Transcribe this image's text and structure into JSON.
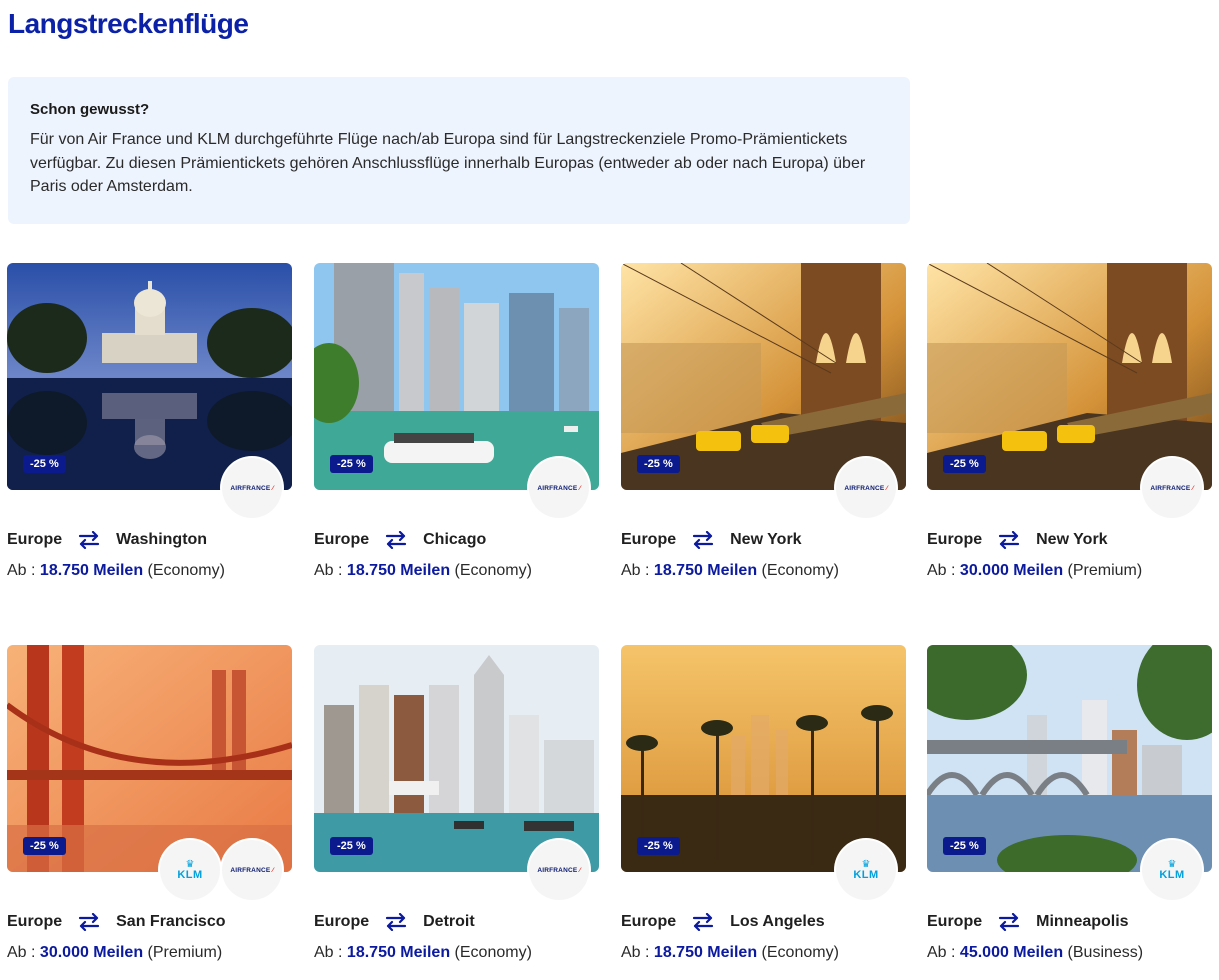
{
  "page": {
    "title": "Langstreckenflüge"
  },
  "info": {
    "title": "Schon gewusst?",
    "text": "Für von Air France und KLM durchgeführte Flüge nach/ab Europa sind für Langstreckenziele Promo-Prämientickets verfügbar. Zu diesen Prämientickets gehören Anschlussflüge innerhalb Europas (entweder ab oder nach Europa) über Paris oder Amsterdam."
  },
  "logo_text": {
    "airfrance": "AIRFRANCE",
    "klm": "KLM"
  },
  "colors": {
    "brand_blue": "#0b22a8",
    "badge": "#0b1a8c",
    "info_bg": "#eef4fd"
  },
  "cards": [
    {
      "image": "washington-capitol",
      "badge": "-25 %",
      "airlines": [
        "airfrance"
      ],
      "origin": "Europe",
      "destination": "Washington",
      "price_prefix": "Ab :",
      "miles": "18.750 Meilen",
      "cabin": "(Economy)"
    },
    {
      "image": "chicago-river",
      "badge": "-25 %",
      "airlines": [
        "airfrance"
      ],
      "origin": "Europe",
      "destination": "Chicago",
      "price_prefix": "Ab :",
      "miles": "18.750 Meilen",
      "cabin": "(Economy)"
    },
    {
      "image": "brooklyn-bridge-taxis",
      "badge": "-25 %",
      "airlines": [
        "airfrance"
      ],
      "origin": "Europe",
      "destination": "New York",
      "price_prefix": "Ab :",
      "miles": "18.750 Meilen",
      "cabin": "(Economy)"
    },
    {
      "image": "brooklyn-bridge-taxis",
      "badge": "-25 %",
      "airlines": [
        "airfrance"
      ],
      "origin": "Europe",
      "destination": "New York",
      "price_prefix": "Ab :",
      "miles": "30.000 Meilen",
      "cabin": "(Premium)"
    },
    {
      "image": "golden-gate-bridge",
      "badge": "-25 %",
      "airlines": [
        "klm",
        "airfrance"
      ],
      "origin": "Europe",
      "destination": "San Francisco",
      "price_prefix": "Ab :",
      "miles": "30.000 Meilen",
      "cabin": "(Premium)"
    },
    {
      "image": "detroit-skyline",
      "badge": "-25 %",
      "airlines": [
        "airfrance"
      ],
      "origin": "Europe",
      "destination": "Detroit",
      "price_prefix": "Ab :",
      "miles": "18.750 Meilen",
      "cabin": "(Economy)"
    },
    {
      "image": "los-angeles-palms",
      "badge": "-25 %",
      "airlines": [
        "klm"
      ],
      "origin": "Europe",
      "destination": "Los Angeles",
      "price_prefix": "Ab :",
      "miles": "18.750 Meilen",
      "cabin": "(Economy)"
    },
    {
      "image": "minneapolis-bridge",
      "badge": "-25 %",
      "airlines": [
        "klm"
      ],
      "origin": "Europe",
      "destination": "Minneapolis",
      "price_prefix": "Ab :",
      "miles": "45.000 Meilen",
      "cabin": "(Business)"
    }
  ]
}
